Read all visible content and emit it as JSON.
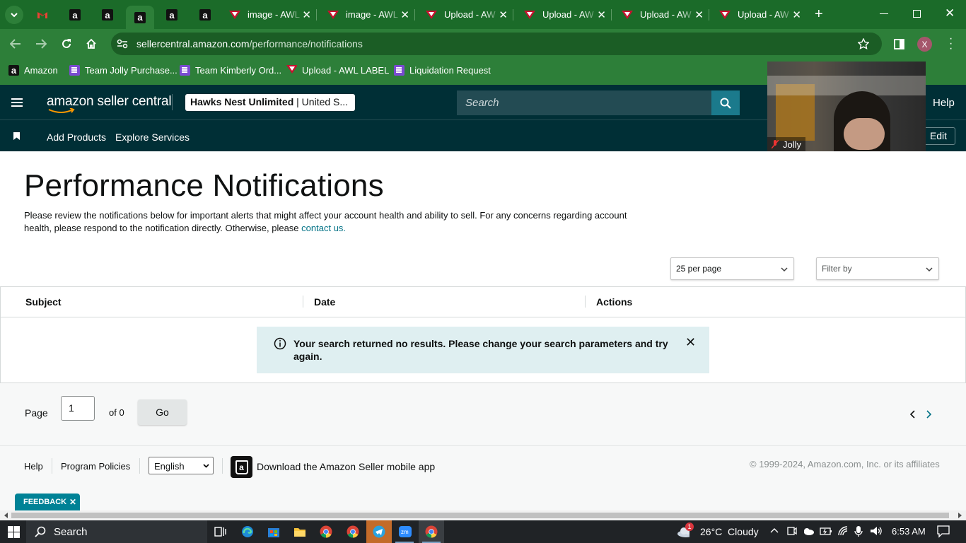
{
  "browser": {
    "tabs": [
      {
        "label": "image - AWL"
      },
      {
        "label": "image - AWL"
      },
      {
        "label": "Upload - AW"
      },
      {
        "label": "Upload - AW"
      },
      {
        "label": "Upload - AW"
      },
      {
        "label": "Upload - AW"
      }
    ],
    "url_host": "sellercentral.amazon.com",
    "url_path": "/performance/notifications",
    "profile_initial": "X",
    "bookmarks": [
      "Amazon",
      "Team Jolly Purchase...",
      "Team Kimberly Ord...",
      "Upload - AWL LABEL",
      "Liquidation Request"
    ]
  },
  "header": {
    "logo_text": "amazon seller central",
    "store_name": "Hawks Nest Unlimited",
    "store_region": "| United S...",
    "search_placeholder": "Search",
    "help": "Help"
  },
  "subnav": {
    "items": [
      "Add Products",
      "Explore Services"
    ],
    "edit": "Edit"
  },
  "video": {
    "name": "Jolly"
  },
  "page": {
    "title": "Performance Notifications",
    "description": "Please review the notifications below for important alerts that might affect your account health and ability to sell. For any concerns regarding account health, please respond to the notification directly. Otherwise, please",
    "contact_link": "contact us."
  },
  "controls": {
    "per_page": "25 per page",
    "filter": "Filter by"
  },
  "table": {
    "columns": [
      "Subject",
      "Date",
      "Actions"
    ],
    "empty_message": "Your search returned no results. Please change your search parameters and try again."
  },
  "pagination": {
    "page_label": "Page",
    "page_value": "1",
    "of_label": "of 0",
    "go": "Go"
  },
  "footer": {
    "help": "Help",
    "policies": "Program Policies",
    "language": "English",
    "app": "Download the Amazon Seller mobile app",
    "copyright": "© 1999-2024, Amazon.com, Inc. or its affiliates",
    "feedback": "FEEDBACK"
  },
  "taskbar": {
    "search": "Search",
    "weather": "26°C  Cloudy",
    "weather_badge": "1",
    "time": "6:53 AM"
  },
  "colors": {
    "chrome_green": "#2d7f39",
    "seller_header": "#002f36",
    "link": "#007185",
    "alert_bg": "#dfeff1"
  }
}
